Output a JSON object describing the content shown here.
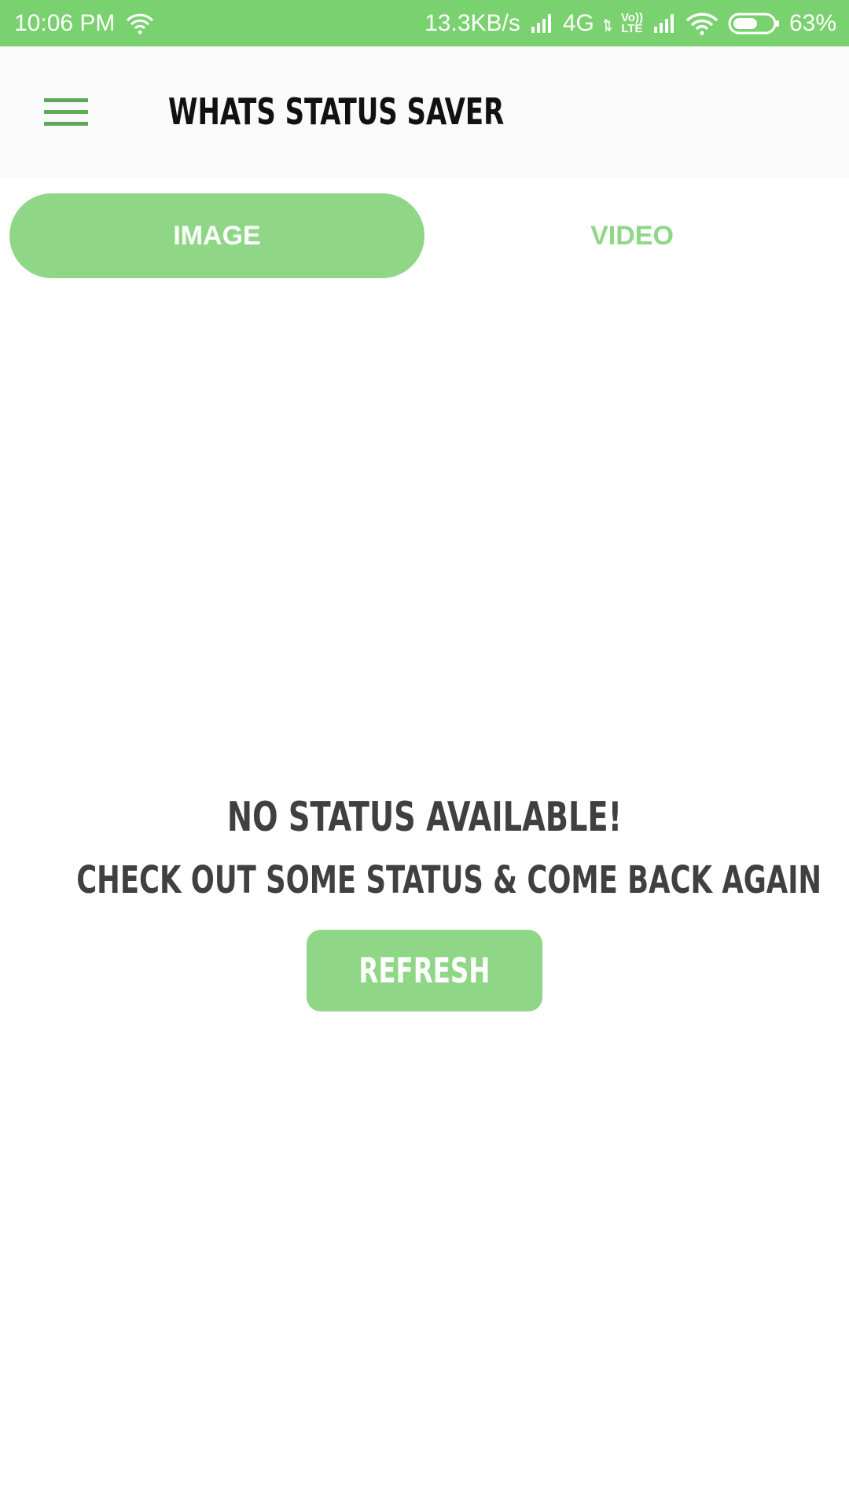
{
  "status_bar": {
    "time": "10:06 PM",
    "net_speed": "13.3KB/s",
    "network_type": "4G",
    "volte_top": "Vo))",
    "volte_bottom": "LTE",
    "battery_percent": "63%",
    "battery_level": 0.63,
    "icons": [
      "wifi-icon",
      "signal-icon",
      "network-arrows-icon",
      "signal-icon",
      "wifi-icon",
      "battery-icon"
    ]
  },
  "toolbar": {
    "menu_icon": "hamburger-menu-icon",
    "title": "WHATS STATUS SAVER"
  },
  "tabs": [
    {
      "label": "IMAGE",
      "selected": true
    },
    {
      "label": "VIDEO",
      "selected": false
    }
  ],
  "empty_state": {
    "title": "NO STATUS AVAILABLE!",
    "subtitle": "CHECK OUT SOME STATUS & COME BACK AGAIN",
    "refresh_label": "REFRESH"
  },
  "colors": {
    "status_bar_bg": "#7ad16f",
    "accent": "#8fd786",
    "menu_icon": "#5fa85a",
    "toolbar_bg": "#fafafa",
    "text_dark": "#404040"
  }
}
